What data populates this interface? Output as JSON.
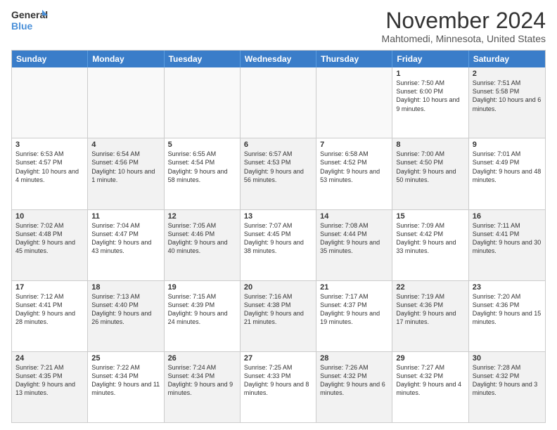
{
  "header": {
    "logo_line1": "General",
    "logo_line2": "Blue",
    "month_title": "November 2024",
    "location": "Mahtomedi, Minnesota, United States"
  },
  "days_of_week": [
    "Sunday",
    "Monday",
    "Tuesday",
    "Wednesday",
    "Thursday",
    "Friday",
    "Saturday"
  ],
  "rows": [
    [
      {
        "day": "",
        "info": "",
        "empty": true
      },
      {
        "day": "",
        "info": "",
        "empty": true
      },
      {
        "day": "",
        "info": "",
        "empty": true
      },
      {
        "day": "",
        "info": "",
        "empty": true
      },
      {
        "day": "",
        "info": "",
        "empty": true
      },
      {
        "day": "1",
        "info": "Sunrise: 7:50 AM\nSunset: 6:00 PM\nDaylight: 10 hours and 9 minutes.",
        "empty": false
      },
      {
        "day": "2",
        "info": "Sunrise: 7:51 AM\nSunset: 5:58 PM\nDaylight: 10 hours and 6 minutes.",
        "empty": false,
        "shaded": true
      }
    ],
    [
      {
        "day": "3",
        "info": "Sunrise: 6:53 AM\nSunset: 4:57 PM\nDaylight: 10 hours and 4 minutes.",
        "empty": false
      },
      {
        "day": "4",
        "info": "Sunrise: 6:54 AM\nSunset: 4:56 PM\nDaylight: 10 hours and 1 minute.",
        "empty": false,
        "shaded": true
      },
      {
        "day": "5",
        "info": "Sunrise: 6:55 AM\nSunset: 4:54 PM\nDaylight: 9 hours and 58 minutes.",
        "empty": false
      },
      {
        "day": "6",
        "info": "Sunrise: 6:57 AM\nSunset: 4:53 PM\nDaylight: 9 hours and 56 minutes.",
        "empty": false,
        "shaded": true
      },
      {
        "day": "7",
        "info": "Sunrise: 6:58 AM\nSunset: 4:52 PM\nDaylight: 9 hours and 53 minutes.",
        "empty": false
      },
      {
        "day": "8",
        "info": "Sunrise: 7:00 AM\nSunset: 4:50 PM\nDaylight: 9 hours and 50 minutes.",
        "empty": false,
        "shaded": true
      },
      {
        "day": "9",
        "info": "Sunrise: 7:01 AM\nSunset: 4:49 PM\nDaylight: 9 hours and 48 minutes.",
        "empty": false
      }
    ],
    [
      {
        "day": "10",
        "info": "Sunrise: 7:02 AM\nSunset: 4:48 PM\nDaylight: 9 hours and 45 minutes.",
        "empty": false,
        "shaded": true
      },
      {
        "day": "11",
        "info": "Sunrise: 7:04 AM\nSunset: 4:47 PM\nDaylight: 9 hours and 43 minutes.",
        "empty": false
      },
      {
        "day": "12",
        "info": "Sunrise: 7:05 AM\nSunset: 4:46 PM\nDaylight: 9 hours and 40 minutes.",
        "empty": false,
        "shaded": true
      },
      {
        "day": "13",
        "info": "Sunrise: 7:07 AM\nSunset: 4:45 PM\nDaylight: 9 hours and 38 minutes.",
        "empty": false
      },
      {
        "day": "14",
        "info": "Sunrise: 7:08 AM\nSunset: 4:44 PM\nDaylight: 9 hours and 35 minutes.",
        "empty": false,
        "shaded": true
      },
      {
        "day": "15",
        "info": "Sunrise: 7:09 AM\nSunset: 4:42 PM\nDaylight: 9 hours and 33 minutes.",
        "empty": false
      },
      {
        "day": "16",
        "info": "Sunrise: 7:11 AM\nSunset: 4:41 PM\nDaylight: 9 hours and 30 minutes.",
        "empty": false,
        "shaded": true
      }
    ],
    [
      {
        "day": "17",
        "info": "Sunrise: 7:12 AM\nSunset: 4:41 PM\nDaylight: 9 hours and 28 minutes.",
        "empty": false
      },
      {
        "day": "18",
        "info": "Sunrise: 7:13 AM\nSunset: 4:40 PM\nDaylight: 9 hours and 26 minutes.",
        "empty": false,
        "shaded": true
      },
      {
        "day": "19",
        "info": "Sunrise: 7:15 AM\nSunset: 4:39 PM\nDaylight: 9 hours and 24 minutes.",
        "empty": false
      },
      {
        "day": "20",
        "info": "Sunrise: 7:16 AM\nSunset: 4:38 PM\nDaylight: 9 hours and 21 minutes.",
        "empty": false,
        "shaded": true
      },
      {
        "day": "21",
        "info": "Sunrise: 7:17 AM\nSunset: 4:37 PM\nDaylight: 9 hours and 19 minutes.",
        "empty": false
      },
      {
        "day": "22",
        "info": "Sunrise: 7:19 AM\nSunset: 4:36 PM\nDaylight: 9 hours and 17 minutes.",
        "empty": false,
        "shaded": true
      },
      {
        "day": "23",
        "info": "Sunrise: 7:20 AM\nSunset: 4:36 PM\nDaylight: 9 hours and 15 minutes.",
        "empty": false
      }
    ],
    [
      {
        "day": "24",
        "info": "Sunrise: 7:21 AM\nSunset: 4:35 PM\nDaylight: 9 hours and 13 minutes.",
        "empty": false,
        "shaded": true
      },
      {
        "day": "25",
        "info": "Sunrise: 7:22 AM\nSunset: 4:34 PM\nDaylight: 9 hours and 11 minutes.",
        "empty": false
      },
      {
        "day": "26",
        "info": "Sunrise: 7:24 AM\nSunset: 4:34 PM\nDaylight: 9 hours and 9 minutes.",
        "empty": false,
        "shaded": true
      },
      {
        "day": "27",
        "info": "Sunrise: 7:25 AM\nSunset: 4:33 PM\nDaylight: 9 hours and 8 minutes.",
        "empty": false
      },
      {
        "day": "28",
        "info": "Sunrise: 7:26 AM\nSunset: 4:32 PM\nDaylight: 9 hours and 6 minutes.",
        "empty": false,
        "shaded": true
      },
      {
        "day": "29",
        "info": "Sunrise: 7:27 AM\nSunset: 4:32 PM\nDaylight: 9 hours and 4 minutes.",
        "empty": false
      },
      {
        "day": "30",
        "info": "Sunrise: 7:28 AM\nSunset: 4:32 PM\nDaylight: 9 hours and 3 minutes.",
        "empty": false,
        "shaded": true
      }
    ]
  ]
}
